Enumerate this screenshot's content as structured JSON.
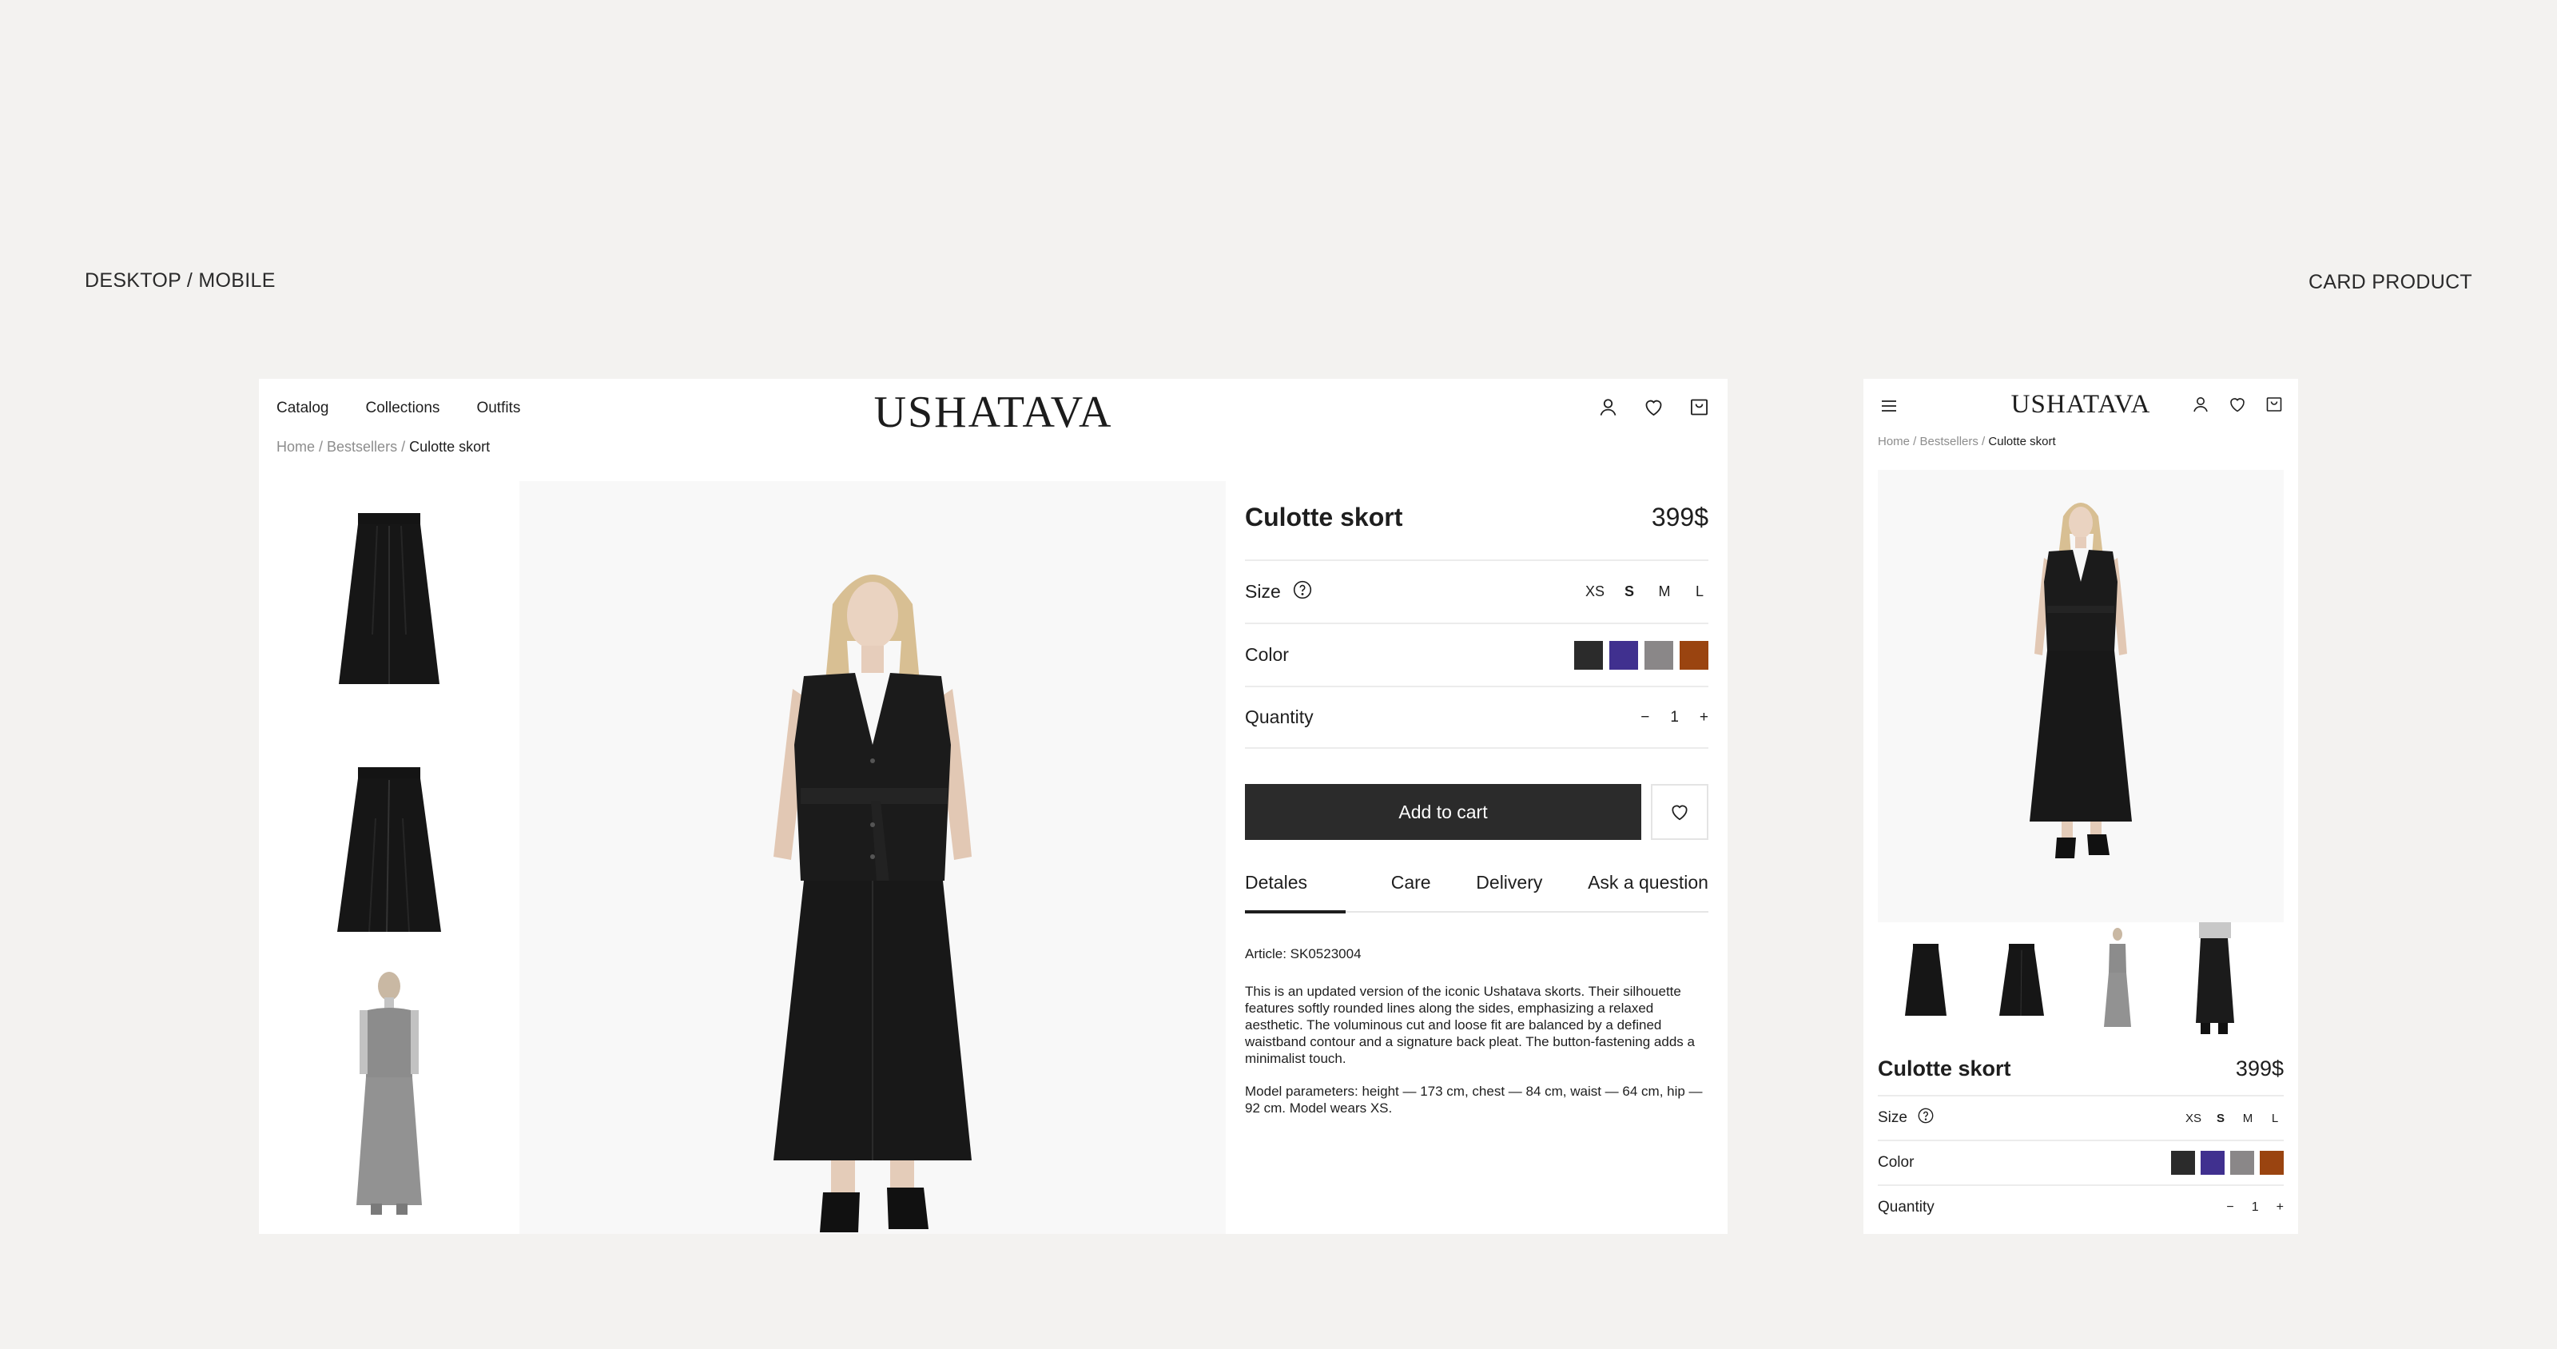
{
  "captions": {
    "left": "DESKTOP /  MOBILE",
    "right": "CARD PRODUCT"
  },
  "brand": "USHATAVA",
  "nav": [
    "Catalog",
    "Collections",
    "Outfits"
  ],
  "breadcrumb": {
    "home": "Home",
    "sep": " / ",
    "section": "Bestsellers",
    "current": "Culotte skort"
  },
  "product": {
    "title": "Culotte skort",
    "price": "399$",
    "size_label": "Size",
    "sizes": [
      "XS",
      "S",
      "M",
      "L"
    ],
    "selected_size": "S",
    "color_label": "Color",
    "colors": [
      "#2b2b2b",
      "#40308f",
      "#8a8788",
      "#9a4410"
    ],
    "quantity_label": "Quantity",
    "quantity": "1",
    "qty_minus": "−",
    "qty_plus": "+",
    "add_to_cart": "Add to cart"
  },
  "tabs": [
    "Detales",
    "Care",
    "Delivery",
    "Ask a question"
  ],
  "details": {
    "article": "Article: SK0523004",
    "description": "This is an updated version of the iconic Ushatava skorts. Their silhouette features softly rounded lines along the sides, emphasizing a relaxed aesthetic. The voluminous cut and loose fit are balanced by a defined waistband contour and a signature back pleat. The button-fastening adds a minimalist touch.",
    "model": "Model parameters: height — 173 cm, chest — 84 cm, waist — 64 cm, hip — 92 cm. Model wears XS."
  },
  "icons": {
    "user": "user-icon",
    "heart": "heart-icon",
    "bag": "bag-icon",
    "help": "question-icon",
    "menu": "menu-icon"
  }
}
